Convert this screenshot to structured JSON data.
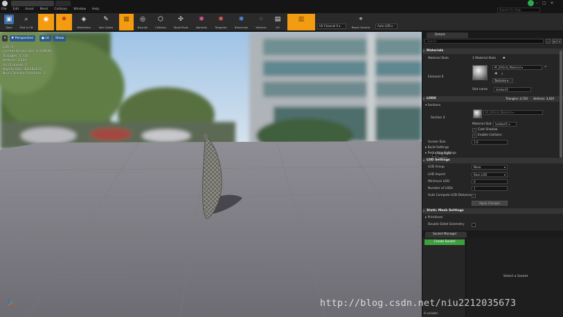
{
  "menu": [
    "File",
    "Edit",
    "Asset",
    "Mesh",
    "Collision",
    "Window",
    "Help"
  ],
  "search_help": {
    "placeholder": "Search For Help"
  },
  "toolbar": {
    "buttons": [
      {
        "label": "Save",
        "icon": "save-icon"
      },
      {
        "label": "Find in CB",
        "icon": "find-in-cb-icon"
      },
      {
        "label": "",
        "icon": "sphere-icon"
      },
      {
        "label": "",
        "icon": "simplygon-icon"
      },
      {
        "label": "Wireframe",
        "icon": "wireframe-icon"
      },
      {
        "label": "Vert Colors",
        "icon": "vert-colors-icon"
      },
      {
        "label": "",
        "icon": "grid-icon"
      },
      {
        "label": "Bounds",
        "icon": "bounds-icon"
      },
      {
        "label": "Collision",
        "icon": "collision-icon"
      },
      {
        "label": "Show Pivot",
        "icon": "pivot-icon"
      },
      {
        "label": "Normals",
        "icon": "normals-icon"
      },
      {
        "label": "Tangents",
        "icon": "tangents-icon"
      },
      {
        "label": "Binormals",
        "icon": "binormals-icon"
      },
      {
        "label": "Vertices",
        "icon": "vertices-icon"
      },
      {
        "label": "UV",
        "icon": "uv-icon"
      },
      {
        "label": "",
        "icon": "uv-overlay-icon"
      },
      {
        "label": "Reset Camera",
        "icon": "reset-camera-icon"
      }
    ],
    "uv_channel": "UV Channel 0",
    "auto_lod": "Auto LOD"
  },
  "viewport": {
    "perspective": "Perspective",
    "lit": "Lit",
    "show": "Show",
    "stats": [
      "LOD:  0",
      "Current Screen Size:  0.569609",
      "Triangles:  4,720",
      "Vertices:  3,420",
      "UV Channels:  1",
      "Approx Size: 30x28x103",
      "Num Collision Primitives:  1"
    ]
  },
  "details": {
    "tab": "Details",
    "search": {
      "placeholder": "Search"
    },
    "materials": {
      "header": "Materials",
      "slots_label": "Material Slots",
      "slots_value": "1 Material Slots",
      "element_label": "Element 0",
      "material_name": "M_UVGrid_Material",
      "textures_btn": "Textures",
      "slot_name_label": "Slot name",
      "slot_name_value": "lambert1"
    },
    "lod0": {
      "header": "LOD0",
      "triangles": "Triangles: 4,720",
      "vertices": "Vertices: 3,420",
      "sections_label": "Sections",
      "section_label": "Section 0",
      "highlight": "Highlight",
      "isolate": "Isolate",
      "material_slot_label": "Material Slot",
      "material_slot_value": "lambert1",
      "cast_shadow": "Cast Shadow",
      "enable_collision": "Enable Collision",
      "screen_size_label": "Screen Size",
      "screen_size_value": "1.0",
      "build_settings": "Build Settings",
      "reduction_settings": "Reduction Settings"
    },
    "lod_settings": {
      "header": "LOD Settings",
      "lod_group_label": "LOD Group",
      "lod_group_value": "None",
      "lod_import_label": "LOD Import",
      "lod_import_value": "Base LOD",
      "min_lod_label": "Minimum LOD",
      "min_lod_value": "0",
      "num_lods_label": "Number of LODs",
      "num_lods_value": "1",
      "auto_compute_label": "Auto Compute LOD Distances",
      "apply_btn": "Apply Changes"
    },
    "static_mesh": {
      "header": "Static Mesh Settings",
      "primitives": "Primitives",
      "double_sided": "Double Sided Geometry"
    }
  },
  "socket_manager": {
    "tab": "Socket Manager",
    "create_btn": "Create Socket",
    "count": "0 sockets",
    "hint": "Select a Socket"
  },
  "watermark": "http://blog.csdn.net/niu2212035673",
  "colors": {
    "accent_orange": "#f39c12",
    "create_green": "#3f9f3f",
    "viewport_button_blue": "#2d5a8c"
  }
}
